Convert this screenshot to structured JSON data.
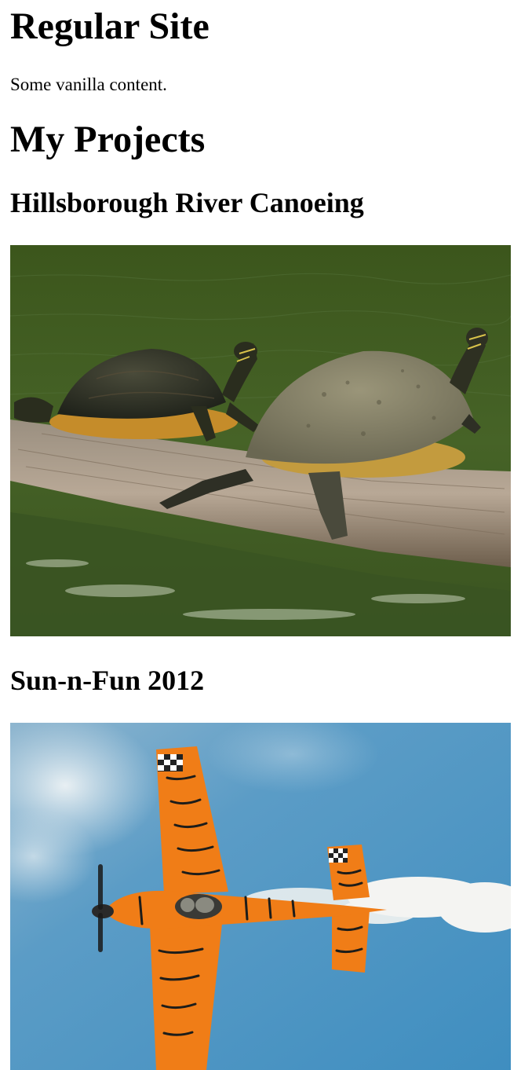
{
  "site": {
    "title": "Regular Site",
    "intro": "Some vanilla content."
  },
  "projects_section": {
    "title": "My Projects",
    "projects": [
      {
        "title": "Hillsborough River Canoeing",
        "image_subject": "turtles-on-log"
      },
      {
        "title": "Sun-n-Fun 2012",
        "image_subject": "orange-tiger-striped-airplane"
      }
    ]
  },
  "colors": {
    "water": "#3f5a1f",
    "sky": "#4d95c2",
    "plane_orange": "#f07d17"
  }
}
